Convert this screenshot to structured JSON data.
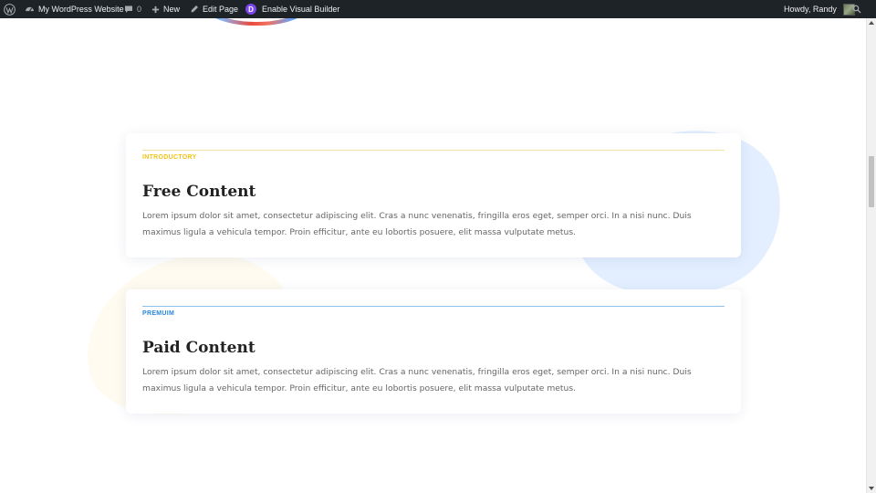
{
  "adminbar": {
    "site_name": "My WordPress Website",
    "comments_count": "0",
    "new_label": "New",
    "edit_label": "Edit Page",
    "visual_builder_label": "Enable Visual Builder",
    "greeting": "Howdy, Randy",
    "icons": [
      "wordpress-logo-icon",
      "dashboard-icon",
      "comment-icon",
      "plus-icon",
      "pencil-icon",
      "divi-logo-icon",
      "avatar",
      "search-icon"
    ]
  },
  "cards": [
    {
      "eyebrow": "INTRODUCTORY",
      "title": "Free Content",
      "body": "Lorem ipsum dolor sit amet, consectetur adipiscing elit. Cras a nunc venenatis, fringilla eros eget, semper orci. In a nisi nunc. Duis maximus ligula a vehicula tempor. Proin efficitur, ante eu lobortis posuere, elit massa vulputate metus.",
      "accent": "#f0c419"
    },
    {
      "eyebrow": "PREMUIM",
      "title": "Paid Content",
      "body": "Lorem ipsum dolor sit amet, consectetur adipiscing elit. Cras a nunc venenatis, fringilla eros eget, semper orci. In a nisi nunc. Duis maximus ligula a vehicula tempor. Proin efficitur, ante eu lobortis posuere, elit massa vulputate metus.",
      "accent": "#2b87da"
    }
  ],
  "colors": {
    "adminbar_bg": "#1d2327",
    "blob_blue": "#e3efff",
    "blob_yellow": "#fffbf0"
  }
}
